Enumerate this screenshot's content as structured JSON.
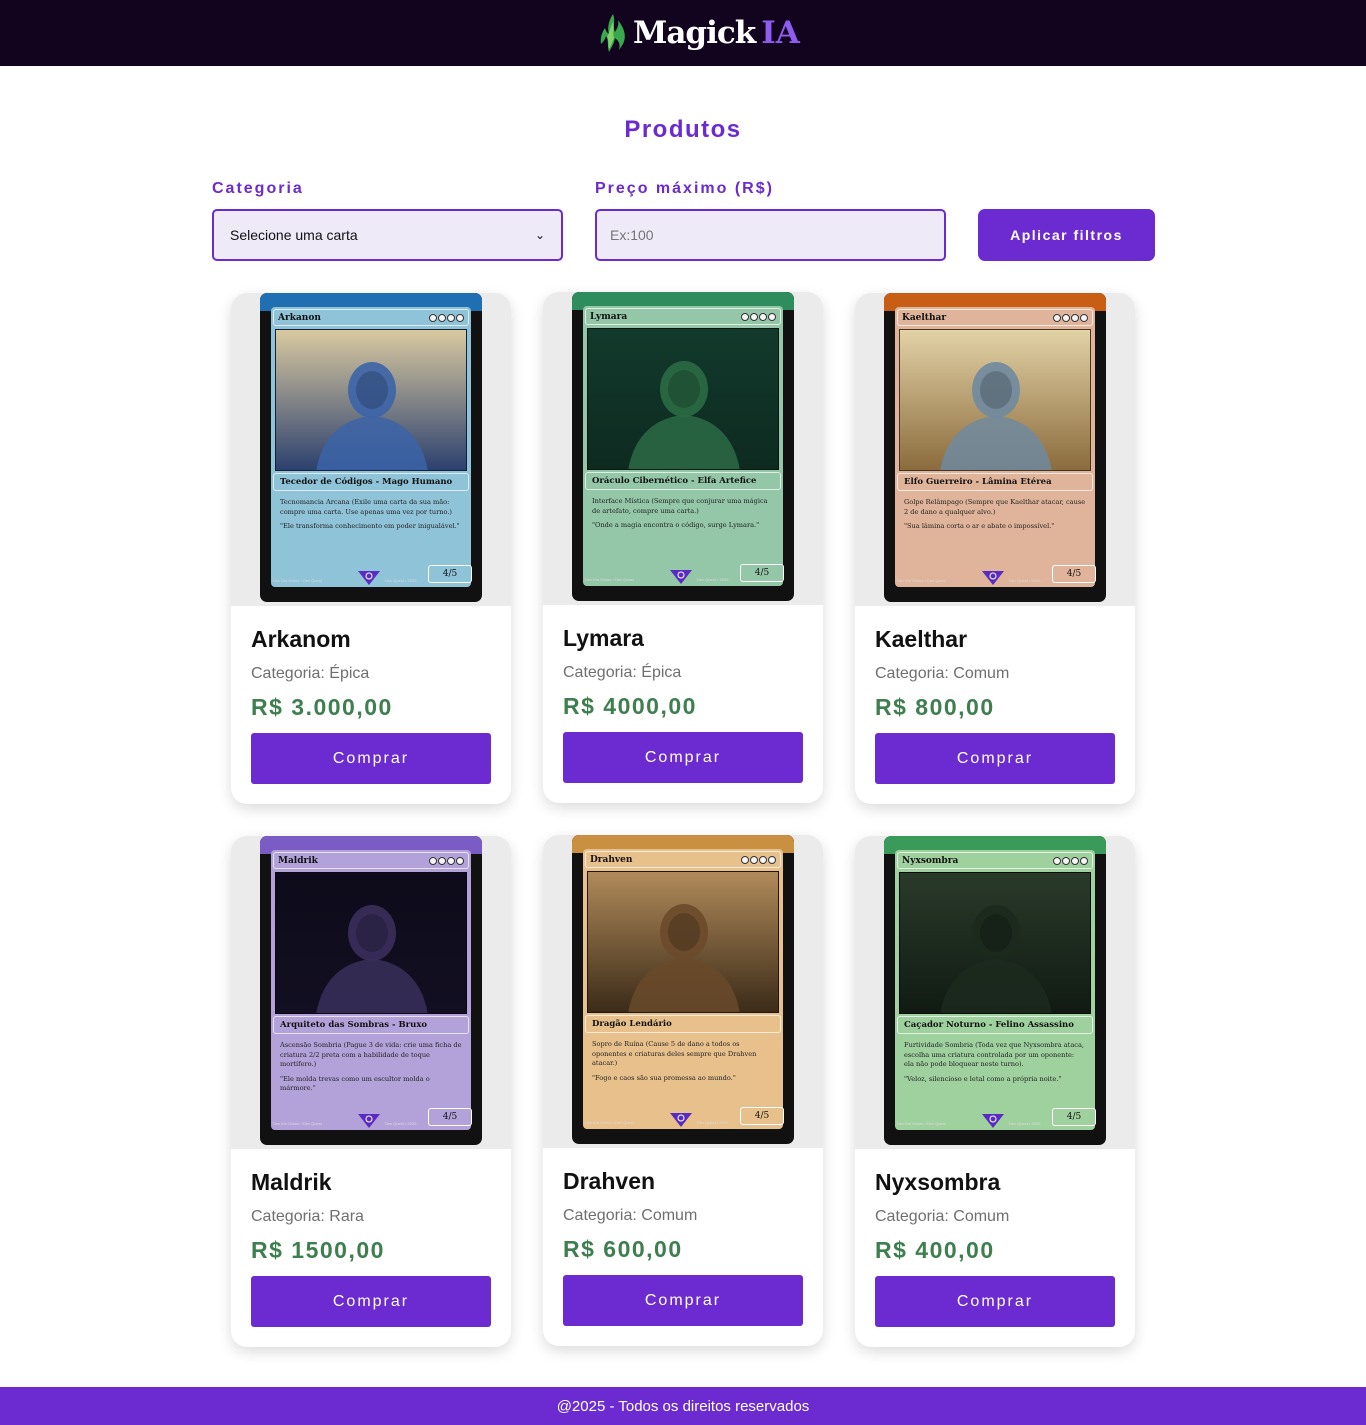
{
  "header": {
    "logo_text": "Magick",
    "logo_suffix": "IA",
    "logo_icon": "green-flame-icon"
  },
  "page": {
    "title": "Produtos"
  },
  "filters": {
    "category_label": "Categoria",
    "category_selected": "Selecione uma carta",
    "price_label": "Preço máximo (R$)",
    "price_placeholder": "Ex:100",
    "apply_label": "Aplicar filtros"
  },
  "buy_label": "Comprar",
  "products": [
    {
      "name": "Arkanom",
      "category": "Categoria: Épica",
      "price": "R$ 3.000,00",
      "card": {
        "title": "Arkanon",
        "type_line": "Tecedor de Códigos - Mago Humano",
        "ability": "Tecnomancia Arcana (Exile uma carta da sua mão: compre uma carta. Use apenas uma vez por turno.)",
        "flavor": "\"Ele transforma conhecimento em poder inigualável.\"",
        "pt": "4/5",
        "credit_left": "Dev Em Dobro • Dev Quest",
        "credit_right": "Dev Quest • 2025",
        "colors": {
          "crest": "#1f6fb2",
          "frame": "#8fc3d8",
          "art_top": "#d9c9a0",
          "art_mid": "#3c64a8",
          "art_bottom": "#2a3f6e"
        }
      }
    },
    {
      "name": "Lymara",
      "category": "Categoria: Épica",
      "price": "R$ 4000,00",
      "card": {
        "title": "Lymara",
        "type_line": "Oráculo Cibernético - Elfa Artefice",
        "ability": "Interface Mística (Sempre que conjurar uma mágica de artefato, compre uma carta.)",
        "flavor": "\"Onde a magia encontra o código, surge Lymara.\"",
        "pt": "4/5",
        "credit_left": "Dev Em Dobro • Dev Quest",
        "credit_right": "Dev Quest • 2025",
        "colors": {
          "crest": "#2f8c5c",
          "frame": "#93c7a8",
          "art_top": "#123a2c",
          "art_mid": "#2b6b45",
          "art_bottom": "#0e2a20"
        }
      }
    },
    {
      "name": "Kaelthar",
      "category": "Categoria: Comum",
      "price": "R$ 800,00",
      "card": {
        "title": "Kaelthar",
        "type_line": "Elfo Guerreiro - Lâmina Etérea",
        "ability": "Golpe Relâmpago (Sempre que Kaelthar atacar, cause 2 de dano a qualquer alvo.)",
        "flavor": "\"Sua lâmina corta o ar e abate o impossível.\"",
        "pt": "4/5",
        "credit_left": "Dev Em Dobro • Dev Quest",
        "credit_right": "Dev Quest • 2025",
        "colors": {
          "crest": "#c85d14",
          "frame": "#e0b49a",
          "art_top": "#e2d2a6",
          "art_mid": "#6f8aa0",
          "art_bottom": "#8a6a3c"
        }
      }
    },
    {
      "name": "Maldrik",
      "category": "Categoria: Rara",
      "price": "R$ 1500,00",
      "card": {
        "title": "Maldrik",
        "type_line": "Arquiteto das Sombras - Bruxo",
        "ability": "Ascensão Sombria (Pague 3 de vida: crie uma ficha de criatura 2/2 preta com a habilidade de toque mortífero.)",
        "flavor": "\"Ele molda trevas como um escultor molda o mármore.\"",
        "pt": "4/5",
        "credit_left": "Dev Em Dobro • Dev Quest",
        "credit_right": "Dev Quest • 2025",
        "colors": {
          "crest": "#7a5cc4",
          "frame": "#b3a2d9",
          "art_top": "#0d0b1a",
          "art_mid": "#3a2f5c",
          "art_bottom": "#130f22"
        }
      }
    },
    {
      "name": "Drahven",
      "category": "Categoria: Comum",
      "price": "R$ 600,00",
      "card": {
        "title": "Drahven",
        "type_line": "Dragão Lendário",
        "ability": "Sopro de Ruína (Cause 5 de dano a todos os oponentes e criaturas deles sempre que Drahven atacar.)",
        "flavor": "\"Fogo e caos são sua promessa ao mundo.\"",
        "pt": "4/5",
        "credit_left": "Dev Em Dobro • Dev Quest",
        "credit_right": "Dev Quest • 2025",
        "colors": {
          "crest": "#c89040",
          "frame": "#e8c08c",
          "art_top": "#b08a5a",
          "art_mid": "#6a4a2a",
          "art_bottom": "#3a2a18"
        }
      }
    },
    {
      "name": "Nyxsombra",
      "category": "Categoria: Comum",
      "price": "R$ 400,00",
      "card": {
        "title": "Nyxsombra",
        "type_line": "Caçador Noturno - Felino Assassino",
        "ability": "Furtividade Sombria (Toda vez que Nyxsombra ataca, escolha uma criatura controlada por um oponente: ela não pode bloquear neste turno).",
        "flavor": "\"Veloz, silencioso e letal como a própria noite.\"",
        "pt": "4/5",
        "credit_left": "Dev Em Dobro • Dev Quest",
        "credit_right": "Dev Quest • 2025",
        "colors": {
          "crest": "#3a9a5a",
          "frame": "#9fd19f",
          "art_top": "#2a3a2a",
          "art_mid": "#1c2a1e",
          "art_bottom": "#101a12"
        }
      }
    }
  ],
  "footer": {
    "text": "@2025 - Todos os direitos reservados"
  },
  "colors": {
    "accent": "#6b2bd0",
    "header_bg": "#12031f",
    "price": "#3f7f4f",
    "input_bg": "#efeaf8"
  }
}
